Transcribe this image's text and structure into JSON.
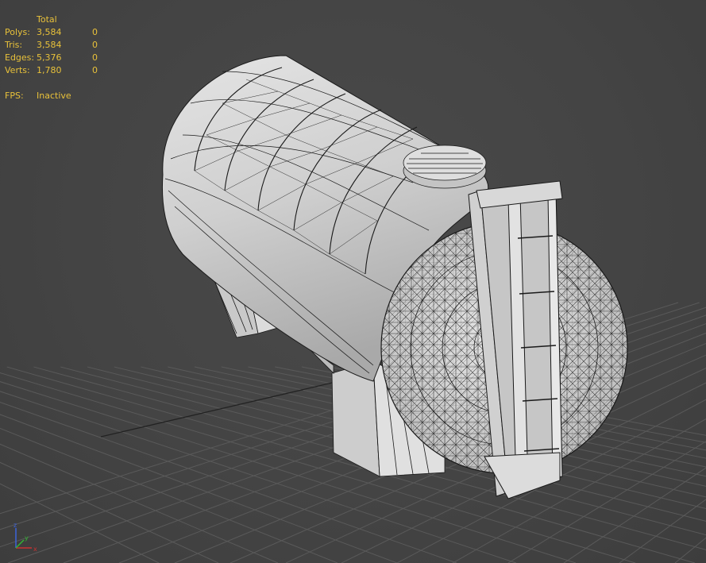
{
  "stats": {
    "header": "Total",
    "rows": [
      {
        "label": "Polys:",
        "total": "3,584",
        "selected": "0"
      },
      {
        "label": "Tris:",
        "total": "3,584",
        "selected": "0"
      },
      {
        "label": "Edges:",
        "total": "5,376",
        "selected": "0"
      },
      {
        "label": "Verts:",
        "total": "1,780",
        "selected": "0"
      }
    ],
    "fps_label": "FPS:",
    "fps_value": "Inactive"
  },
  "colors": {
    "stats_text": "#e8c13a",
    "viewport_bg": "#444444",
    "grid": "#5a5a5a",
    "mesh_fill": "#d6d6d6",
    "wire": "#1a1a1a",
    "axis_x": "#c83232",
    "axis_y": "#32b432",
    "axis_z": "#3c64dc"
  },
  "icons": {
    "gizmo": "axis-tripod-icon"
  }
}
